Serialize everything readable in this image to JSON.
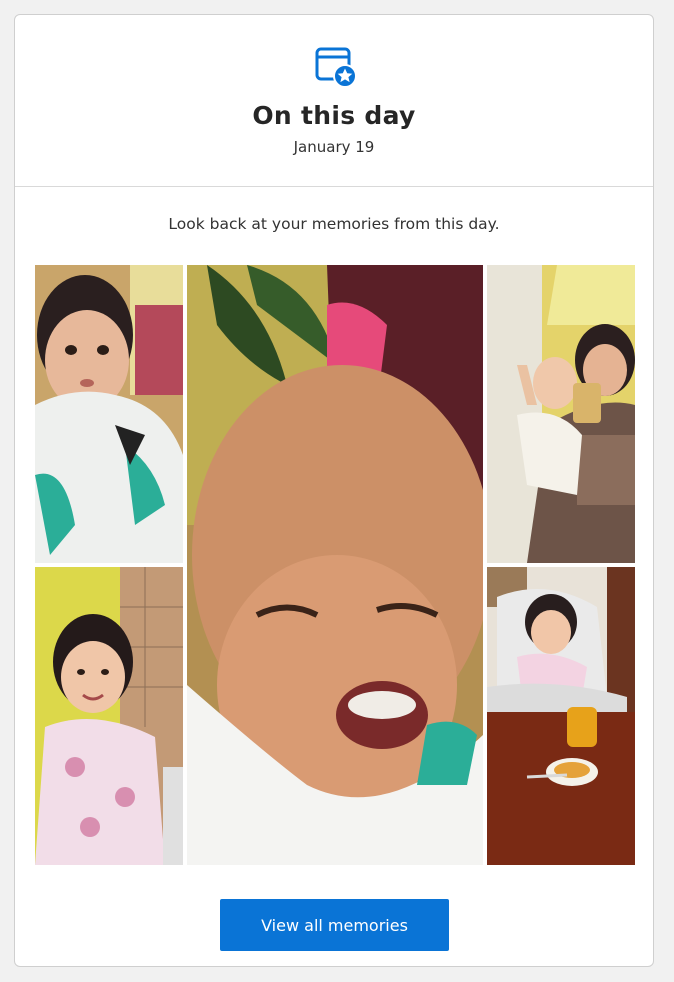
{
  "header": {
    "icon": "calendar-star-icon",
    "title": "On this day",
    "date": "January 19"
  },
  "body": {
    "subtitle": "Look back at your memories from this day."
  },
  "photos": [
    {
      "id": "photo-1",
      "description": "toddler in bib"
    },
    {
      "id": "photo-2",
      "description": "crying baby"
    },
    {
      "id": "photo-3",
      "description": "man holding baby selfie"
    },
    {
      "id": "photo-4",
      "description": "toddler in pajamas"
    },
    {
      "id": "photo-5",
      "description": "baby in high chair"
    }
  ],
  "actions": {
    "view_all_label": "View all memories"
  },
  "colors": {
    "accent": "#0a74d6",
    "card_bg": "#ffffff",
    "page_bg": "#f1f1f1"
  }
}
